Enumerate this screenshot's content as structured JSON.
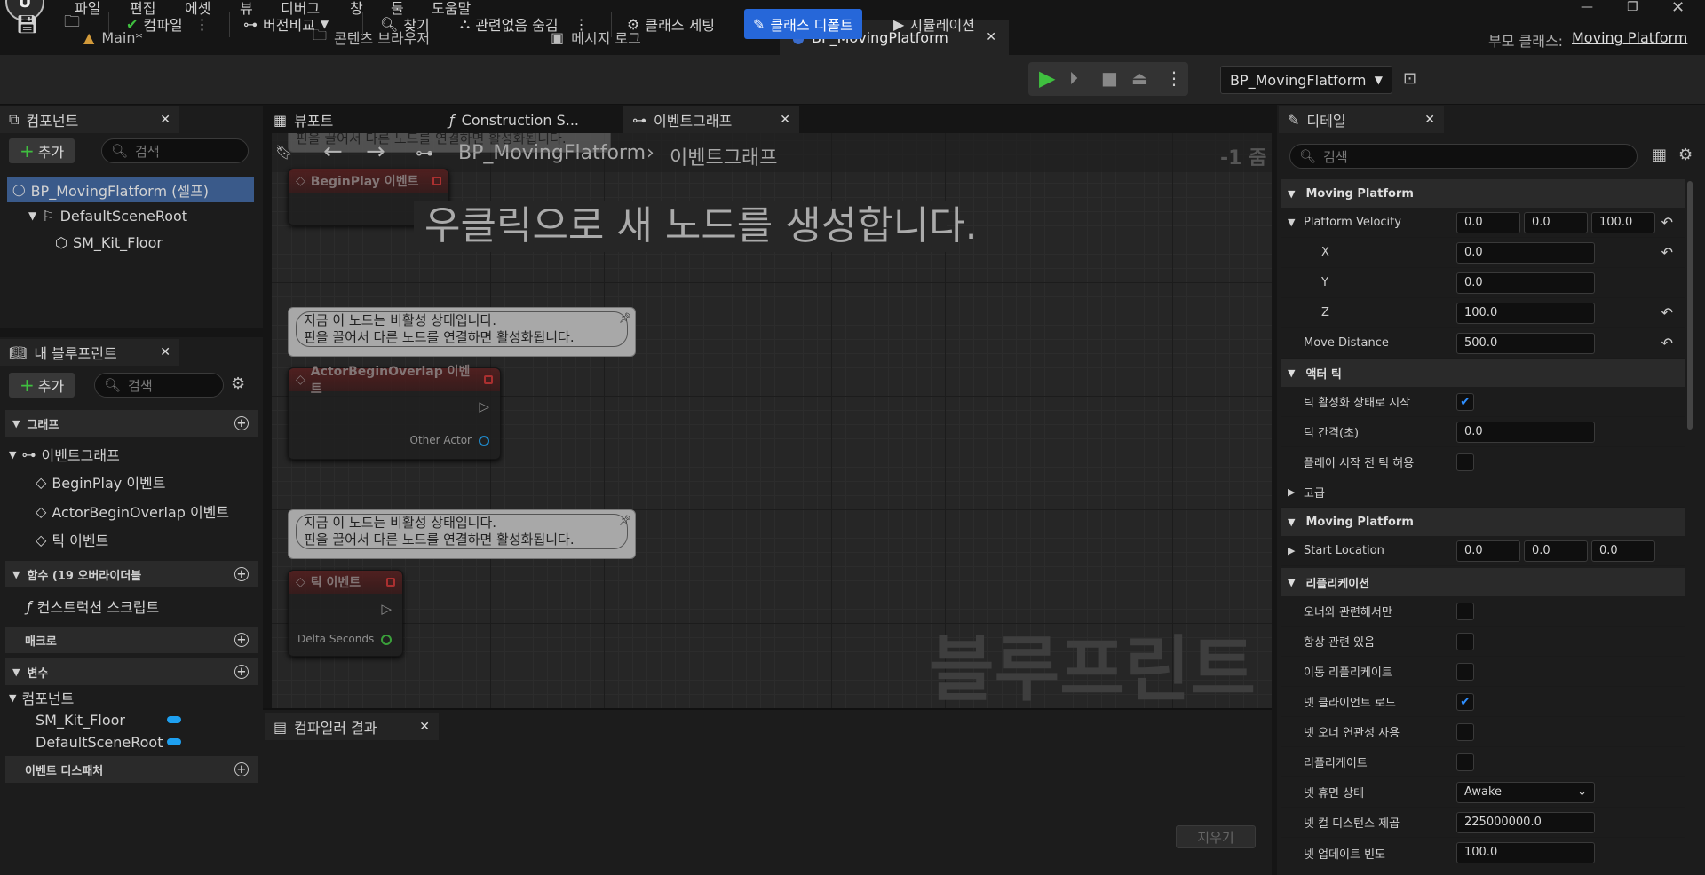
{
  "app": {
    "logo": "unreal-logo"
  },
  "menu": [
    "파일",
    "편집",
    "에셋",
    "뷰",
    "디버그",
    "창",
    "툴",
    "도움말"
  ],
  "tabs": [
    {
      "label": "Main*",
      "icon": "level-icon"
    },
    {
      "label": "콘텐츠 브라우저",
      "icon": "folder-icon"
    },
    {
      "label": "메시지 로그",
      "icon": "log-icon"
    },
    {
      "label": "BP_MovingPlatform",
      "icon": "blueprint-icon"
    }
  ],
  "parent_class": {
    "label": "부모 클래스:",
    "value": "Moving Platform"
  },
  "toolbar": {
    "compile": "컴파일",
    "diff": "버전비교",
    "find": "찾기",
    "hide_unrelated": "관련없음 숨김",
    "class_settings": "클래스 세팅",
    "class_defaults": "클래스 디폴트",
    "simulation": "시뮬레이션",
    "debug_object": "BP_MovingFlatform"
  },
  "components_panel": {
    "title": "컴포넌트",
    "add": "추가",
    "search_placeholder": "검색",
    "items": [
      "BP_MovingFlatform (셀프)",
      "DefaultSceneRoot",
      "SM_Kit_Floor"
    ]
  },
  "my_blueprint": {
    "title": "내 블루프린트",
    "add": "추가",
    "search_placeholder": "검색",
    "sections": {
      "graphs": "그래프",
      "eventgraph": "이벤트그래프",
      "events": [
        "BeginPlay 이벤트",
        "ActorBeginOverlap 이벤트",
        "틱 이벤트"
      ],
      "functions": "함수 (19 오버라이더블",
      "construction": "컨스트럭션 스크립트",
      "macros": "매크로",
      "variables": "변수",
      "components": "컴포넌트",
      "vars": [
        "SM_Kit_Floor",
        "DefaultSceneRoot"
      ],
      "dispatchers": "이벤트 디스패처"
    }
  },
  "graph_tabs": [
    "뷰포트",
    "Construction S...",
    "이벤트그래프"
  ],
  "graph": {
    "breadcrumb_bp": "BP_MovingFlatform",
    "breadcrumb_graph": "이벤트그래프",
    "zoom": "-1 줌",
    "hint": "우클릭으로 새 노드를 생성합니다.",
    "watermark": "블루프린트",
    "bubble_top_partial": "핀을 끌어서 다른 노드를 연결하면 활성화됩니다.",
    "bubble_line1": "지금 이 노드는 비활성 상태입니다.",
    "bubble_line2": "핀을 끌어서 다른 노드를 연결하면 활성화됩니다.",
    "nodes": [
      {
        "title": "BeginPlay 이벤트",
        "pin": ""
      },
      {
        "title": "ActorBeginOverlap 이벤트",
        "pin": "Other Actor"
      },
      {
        "title": "틱 이벤트",
        "pin": "Delta Seconds"
      }
    ]
  },
  "compiler": {
    "title": "컴파일러 결과",
    "clear": "지우기"
  },
  "details": {
    "title": "디테일",
    "search_placeholder": "검색",
    "sec_moving": "Moving Platform",
    "velocity_label": "Platform Velocity",
    "velocity": [
      "0.0",
      "0.0",
      "100.0"
    ],
    "x_label": "X",
    "x": "0.0",
    "y_label": "Y",
    "y": "0.0",
    "z_label": "Z",
    "z": "100.0",
    "move_distance_label": "Move Distance",
    "move_distance": "500.0",
    "sec_tick": "액터 틱",
    "tick_start_label": "틱 활성화 상태로 시작",
    "tick_interval_label": "틱 간격(초)",
    "tick_interval": "0.0",
    "tick_before_label": "플레이 시작 전 틱 허용",
    "advanced": "고급",
    "sec_moving2": "Moving Platform",
    "start_location_label": "Start Location",
    "start_location": [
      "0.0",
      "0.0",
      "0.0"
    ],
    "sec_replication": "리플리케이션",
    "rep_labels": [
      "오너와 관련해서만",
      "항상 관련 있음",
      "이동 리플리케이트",
      "넷 클라이언트 로드",
      "넷 오너 연관성 사용",
      "리플리케이트"
    ],
    "rep_checked": [
      false,
      false,
      false,
      true,
      false,
      false
    ],
    "dormancy_label": "넷 휴면 상태",
    "dormancy": "Awake",
    "cull_label": "넷 컬 디스턴스 제곱",
    "cull": "225000000.0",
    "update_label": "넷 업데이트 빈도",
    "update": "100.0"
  }
}
